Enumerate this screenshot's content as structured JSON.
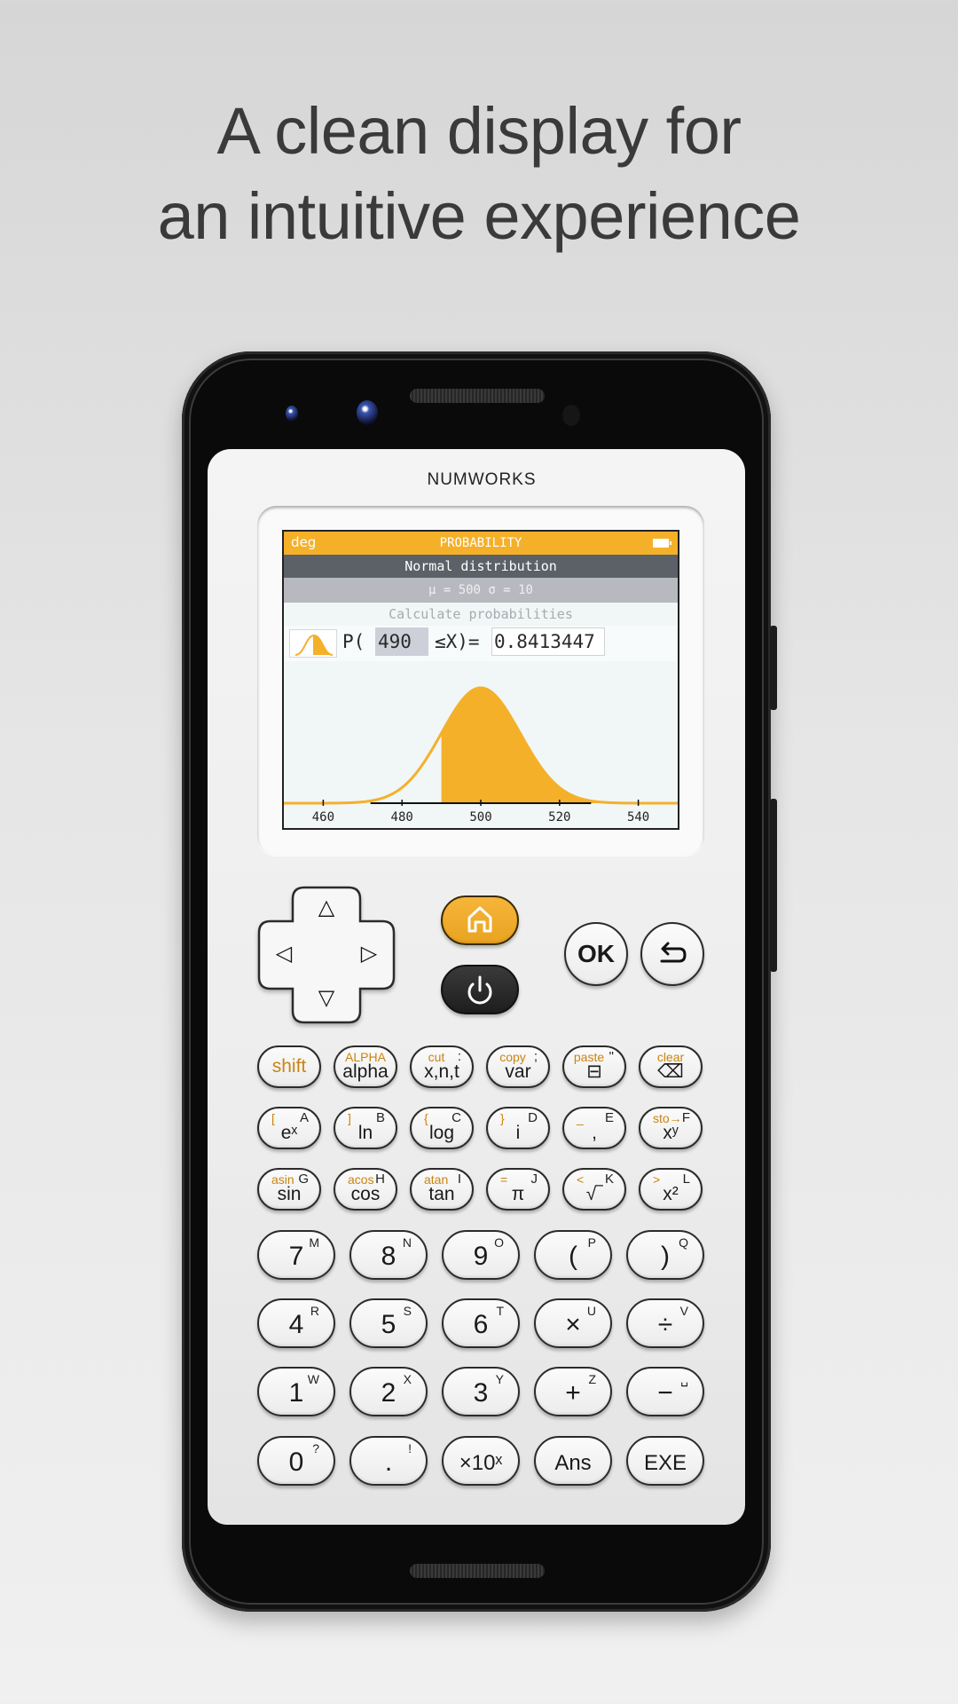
{
  "headline": {
    "line1": "A clean display for",
    "line2": "an intuitive experience"
  },
  "calculator": {
    "brand": "NUMWORKS",
    "screen": {
      "angle_mode": "deg",
      "app_title": "PROBABILITY",
      "battery_icon": "battery-full-icon",
      "distribution": "Normal distribution",
      "parameters": "μ = 500 σ = 10",
      "section_label": "Calculate probabilities",
      "probability": {
        "prefix": "P(",
        "input_value": "490",
        "relation": "≤X)=",
        "result": "0.8413447"
      },
      "colors": {
        "accent": "#f5b02a",
        "header_dark": "#5c6168",
        "header_grey": "#b8b9bf"
      }
    },
    "nav_keys": {
      "up": "△",
      "down": "▽",
      "left": "◁",
      "right": "▷",
      "home_icon": "home-icon",
      "power_icon": "power-icon",
      "ok": "OK",
      "back_icon": "back-arrow-icon"
    },
    "function_keys": [
      [
        {
          "main": "shift",
          "top": "",
          "alt": "",
          "main_orange": true
        },
        {
          "main": "alpha",
          "top": "ALPHA",
          "alt": ""
        },
        {
          "main": "x,n,t",
          "top": "cut",
          "alt": ":"
        },
        {
          "main": "var",
          "top": "copy",
          "alt": ";"
        },
        {
          "main": "⊟",
          "top": "paste",
          "alt": "\"",
          "icon": "toolbox-icon"
        },
        {
          "main": "⌫",
          "top": "clear",
          "alt": "",
          "icon": "backspace-icon"
        }
      ],
      [
        {
          "main": "eˣ",
          "top": "[",
          "alt": "A"
        },
        {
          "main": "ln",
          "top": "]",
          "alt": "B"
        },
        {
          "main": "log",
          "top": "{",
          "alt": "C"
        },
        {
          "main": "i",
          "top": "}",
          "alt": "D"
        },
        {
          "main": ",",
          "top": "_",
          "alt": "E"
        },
        {
          "main": "xʸ",
          "top": "sto→",
          "alt": "F"
        }
      ],
      [
        {
          "main": "sin",
          "top": "asin",
          "alt": "G"
        },
        {
          "main": "cos",
          "top": "acos",
          "alt": "H"
        },
        {
          "main": "tan",
          "top": "atan",
          "alt": "I"
        },
        {
          "main": "π",
          "top": "=",
          "alt": "J"
        },
        {
          "main": "√‾",
          "top": "<",
          "alt": "K"
        },
        {
          "main": "x²",
          "top": ">",
          "alt": "L"
        }
      ]
    ],
    "number_keys": [
      [
        {
          "main": "7",
          "sup": "M"
        },
        {
          "main": "8",
          "sup": "N"
        },
        {
          "main": "9",
          "sup": "O"
        },
        {
          "main": "(",
          "sup": "P"
        },
        {
          "main": ")",
          "sup": "Q"
        }
      ],
      [
        {
          "main": "4",
          "sup": "R"
        },
        {
          "main": "5",
          "sup": "S"
        },
        {
          "main": "6",
          "sup": "T"
        },
        {
          "main": "×",
          "sup": "U"
        },
        {
          "main": "÷",
          "sup": "V"
        }
      ],
      [
        {
          "main": "1",
          "sup": "W"
        },
        {
          "main": "2",
          "sup": "X"
        },
        {
          "main": "3",
          "sup": "Y"
        },
        {
          "main": "+",
          "sup": "Z"
        },
        {
          "main": "−",
          "sup": "␣"
        }
      ],
      [
        {
          "main": "0",
          "sup": "?"
        },
        {
          "main": ".",
          "sup": "!"
        },
        {
          "main": "×10ˣ",
          "sup": ""
        },
        {
          "main": "Ans",
          "sup": ""
        },
        {
          "main": "EXE",
          "sup": ""
        }
      ]
    ]
  },
  "chart_data": {
    "type": "area",
    "title": "Normal distribution",
    "distribution": "normal",
    "mean": 500,
    "sd": 10,
    "shaded_from": 490,
    "shaded_to": null,
    "shaded_probability": 0.8413447,
    "x_ticks": [
      460,
      480,
      500,
      520,
      540
    ],
    "xlim": [
      450,
      550
    ],
    "xlabel": "",
    "ylabel": "",
    "grid": false,
    "color": "#f5b02a"
  }
}
